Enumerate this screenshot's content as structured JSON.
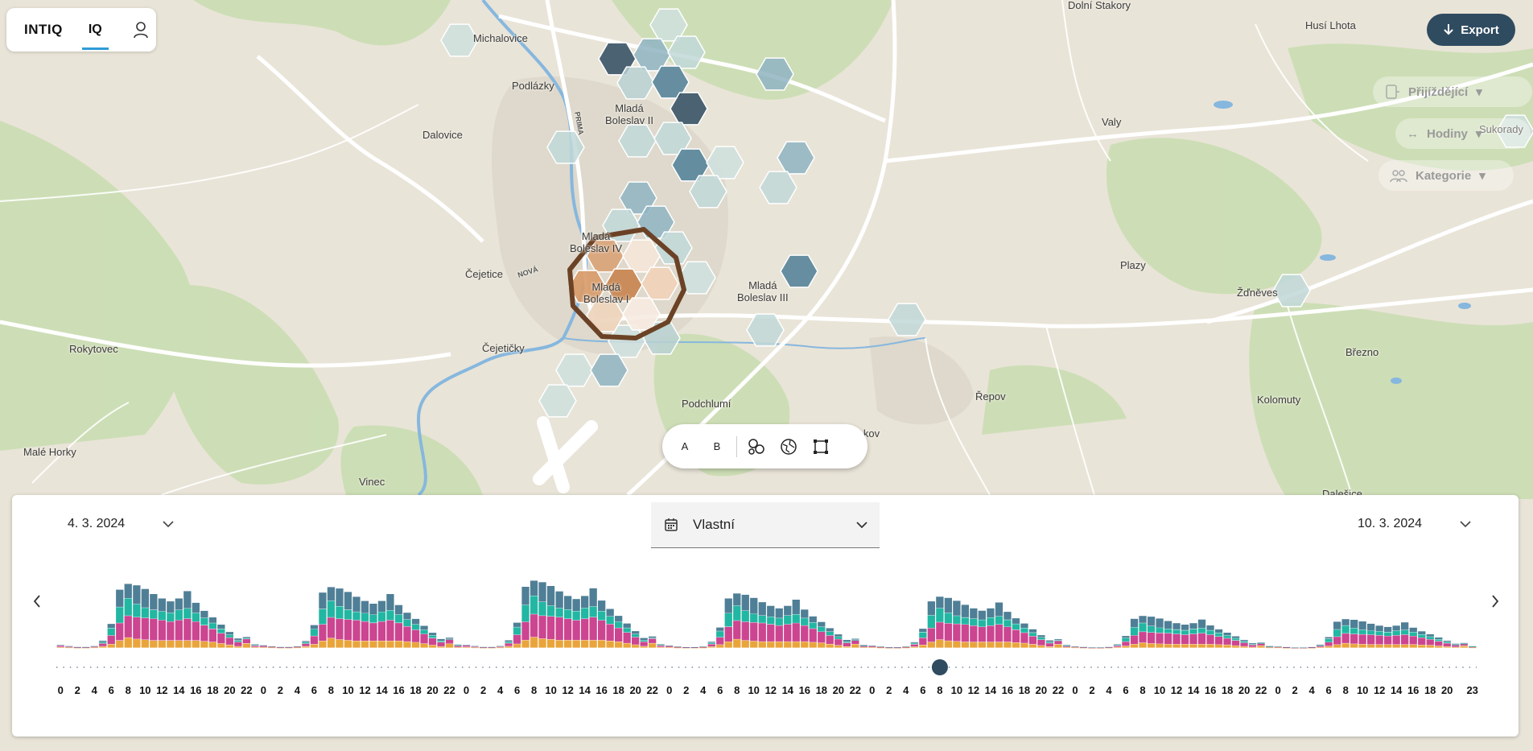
{
  "app": {
    "logo": "INTIQ",
    "tab": "IQ"
  },
  "export": {
    "label": "Export"
  },
  "side_controls": [
    {
      "label": "Přijíždějící",
      "icon": "arrivals-icon"
    },
    {
      "label": "Hodiny",
      "icon": "arrows-horizontal-icon"
    },
    {
      "label": "Kategorie",
      "icon": "people-icon"
    }
  ],
  "map": {
    "places": [
      {
        "name": "Dolní Stakory"
      },
      {
        "name": "Husí Lhota"
      },
      {
        "name": "Michalovice"
      },
      {
        "name": "Podlázky"
      },
      {
        "name": "Mladá Boleslav II"
      },
      {
        "name": "Dalovice"
      },
      {
        "name": "Valy"
      },
      {
        "name": "Sukorady"
      },
      {
        "name": "Mladá Boleslav IV"
      },
      {
        "name": "Čejetice"
      },
      {
        "name": "Mladá Boleslav I"
      },
      {
        "name": "Mladá Boleslav III"
      },
      {
        "name": "Plazy"
      },
      {
        "name": "Žďněves"
      },
      {
        "name": "Rokytovec"
      },
      {
        "name": "Čejetičky"
      },
      {
        "name": "Březno"
      },
      {
        "name": "Podchlumí"
      },
      {
        "name": "Řepov"
      },
      {
        "name": "Kolomuty"
      },
      {
        "name": "Malé Horky"
      },
      {
        "name": "Vinec"
      },
      {
        "name": "Bakov"
      },
      {
        "name": "Dalešice"
      }
    ],
    "road_labels": [
      "NOVÁ",
      "PRIMA"
    ]
  },
  "tools": [
    {
      "label": "A",
      "icon": ""
    },
    {
      "label": "B",
      "icon": ""
    },
    {
      "label": "",
      "icon": "compare-areas-icon"
    },
    {
      "label": "",
      "icon": "globe-area-icon"
    },
    {
      "label": "",
      "icon": "select-rectangle-icon"
    }
  ],
  "timeline": {
    "date_from": "4. 3. 2024",
    "date_to": "10. 3. 2024",
    "range_label": "Vlastní",
    "slider_position_hours": 104,
    "colors": {
      "orange": "#e9a53c",
      "pink": "#cc4590",
      "teal": "#22b7a2",
      "slate": "#4f7f96"
    }
  },
  "chart_data": {
    "type": "bar",
    "stacked": true,
    "x": [
      0,
      1,
      2,
      3,
      4,
      5,
      6,
      7,
      8,
      9,
      10,
      11,
      12,
      13,
      14,
      15,
      16,
      17,
      18,
      19,
      20,
      21,
      22,
      23,
      24,
      25,
      26,
      27,
      28,
      29,
      30,
      31,
      32,
      33,
      34,
      35,
      36,
      37,
      38,
      39,
      40,
      41,
      42,
      43,
      44,
      45,
      46,
      47,
      48,
      49,
      50,
      51,
      52,
      53,
      54,
      55,
      56,
      57,
      58,
      59,
      60,
      61,
      62,
      63,
      64,
      65,
      66,
      67,
      68,
      69,
      70,
      71,
      72,
      73,
      74,
      75,
      76,
      77,
      78,
      79,
      80,
      81,
      82,
      83,
      84,
      85,
      86,
      87,
      88,
      89,
      90,
      91,
      92,
      93,
      94,
      95,
      96,
      97,
      98,
      99,
      100,
      101,
      102,
      103,
      104,
      105,
      106,
      107,
      108,
      109,
      110,
      111,
      112,
      113,
      114,
      115,
      116,
      117,
      118,
      119,
      120,
      121,
      122,
      123,
      124,
      125,
      126,
      127,
      128,
      129,
      130,
      131,
      132,
      133,
      134,
      135,
      136,
      137,
      138,
      139,
      140,
      141,
      142,
      143,
      144,
      145,
      146,
      147,
      148,
      149,
      150,
      151,
      152,
      153,
      154,
      155,
      156,
      157,
      158,
      159,
      160,
      161,
      162,
      163,
      164,
      165,
      166,
      167
    ],
    "tick_labels": [
      "0",
      "2",
      "4",
      "6",
      "8",
      "10",
      "12",
      "14",
      "16",
      "18",
      "20",
      "22",
      "0",
      "2",
      "4",
      "6",
      "8",
      "10",
      "12",
      "14",
      "16",
      "18",
      "20",
      "22",
      "0",
      "2",
      "4",
      "6",
      "8",
      "10",
      "12",
      "14",
      "16",
      "18",
      "20",
      "22",
      "0",
      "2",
      "4",
      "6",
      "8",
      "10",
      "12",
      "14",
      "16",
      "18",
      "20",
      "22",
      "0",
      "2",
      "4",
      "6",
      "8",
      "10",
      "12",
      "14",
      "16",
      "18",
      "20",
      "22",
      "0",
      "2",
      "4",
      "6",
      "8",
      "10",
      "12",
      "14",
      "16",
      "18",
      "20",
      "22",
      "0",
      "2",
      "4",
      "6",
      "8",
      "10",
      "12",
      "14",
      "16",
      "18",
      "20",
      "23"
    ],
    "series": [],
    "weekday_profile": {
      "orange": [
        1,
        0.5,
        0.3,
        0.3,
        0.5,
        2,
        5,
        10,
        14,
        12,
        11,
        10,
        10,
        10,
        10,
        10,
        10,
        9,
        8,
        6,
        4,
        2,
        6,
        1
      ],
      "pink": [
        2,
        1,
        0.5,
        0.5,
        1,
        4,
        12,
        24,
        30,
        30,
        30,
        30,
        28,
        26,
        28,
        30,
        26,
        22,
        18,
        14,
        10,
        6,
        6,
        2
      ],
      "teal": [
        0,
        0,
        0,
        0,
        0,
        2,
        10,
        22,
        24,
        18,
        14,
        12,
        12,
        12,
        14,
        14,
        12,
        10,
        8,
        6,
        4,
        2,
        1,
        1
      ],
      "slate": [
        1,
        1,
        0.5,
        0.5,
        1,
        2,
        6,
        24,
        20,
        26,
        26,
        22,
        18,
        16,
        16,
        24,
        14,
        10,
        8,
        6,
        4,
        3,
        2,
        1
      ]
    },
    "day_scale": [
      1.0,
      0.95,
      1.05,
      0.85,
      0.8,
      0.5,
      0.45
    ],
    "ylim": [
      0,
      105
    ]
  }
}
